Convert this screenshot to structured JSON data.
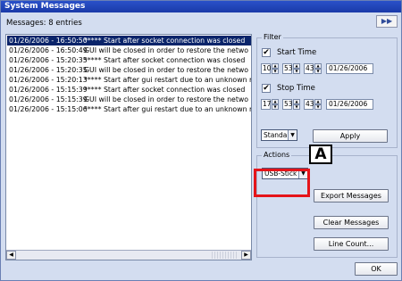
{
  "window": {
    "title": "System Messages"
  },
  "list": {
    "entries_label": "Messages: 8 entries",
    "rows": [
      {
        "time": "01/26/2006 - 16:50:50",
        "text": "***** Start after socket connection was closed"
      },
      {
        "time": "01/26/2006 - 16:50:49",
        "text": "GUI will be closed in order to restore the netwo"
      },
      {
        "time": "01/26/2006 - 15:20:35",
        "text": "***** Start after socket connection was closed"
      },
      {
        "time": "01/26/2006 - 15:20:35",
        "text": "GUI will be closed in order to restore the netwo"
      },
      {
        "time": "01/26/2006 - 15:20:13",
        "text": "***** Start after gui restart due to an unknown r"
      },
      {
        "time": "01/26/2006 - 15:15:39",
        "text": "***** Start after socket connection was closed"
      },
      {
        "time": "01/26/2006 - 15:15:39",
        "text": "GUI will be closed in order to restore the netwo"
      },
      {
        "time": "01/26/2006 - 15:15:06",
        "text": "***** Start after gui restart due to an unknown r"
      }
    ],
    "scroll_left": "◀",
    "scroll_right": "▶"
  },
  "nav": {
    "forward_label": "▶▶"
  },
  "filter": {
    "label": "Filter",
    "start_time": {
      "label": "Start Time",
      "checked": "✔",
      "hour": "10",
      "minute": "53",
      "second": "43",
      "date": "01/26/2006"
    },
    "stop_time": {
      "label": "Stop Time",
      "checked": "✔",
      "hour": "17",
      "minute": "53",
      "second": "43",
      "date": "01/26/2006"
    },
    "mode": "Standard",
    "apply_label": "Apply"
  },
  "actions": {
    "label": "Actions",
    "target": "USB-Stick",
    "export_label": "Export Messages",
    "clear_label": "Clear Messages",
    "count_label": "Line Count..."
  },
  "footer": {
    "ok_label": "OK"
  },
  "annotation": {
    "callout": "A",
    "highlight_color": "#e5141a"
  },
  "icons": {
    "spin_up": "▲",
    "spin_down": "▼",
    "dropdown": "▼"
  }
}
